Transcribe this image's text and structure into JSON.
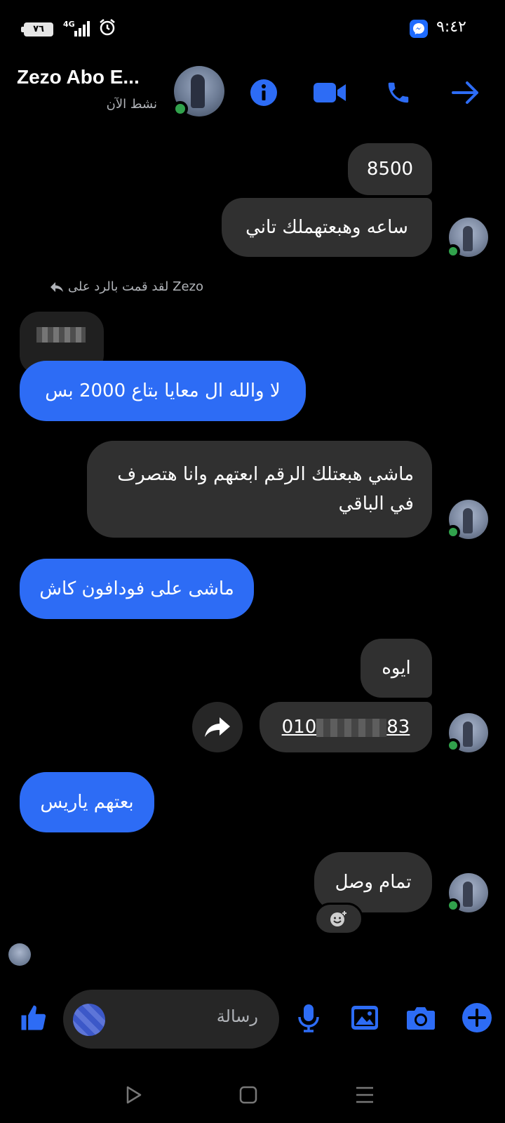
{
  "status_bar": {
    "battery": "٧٦",
    "network": "4G",
    "time": "٩:٤٢",
    "icons": [
      "signal-icon",
      "alarm-icon",
      "messenger-notification-icon"
    ]
  },
  "header": {
    "contact_name": "Zezo Abo E...",
    "contact_status": "نشط الآن",
    "icons": [
      "info-icon",
      "video-call-icon",
      "phone-call-icon",
      "back-arrow-icon"
    ]
  },
  "conversation": {
    "msg1": "8500",
    "msg2": "ساعه وهبعتهملك تاني",
    "reply_note": "لقد قمت بالرد على Zezo",
    "msg3": "لا والله ال معايا بتاع 2000 بس",
    "msg4_line1": "ماشي هبعتلك الرقم ابعتهم وانا هتصرف",
    "msg4_line2": "في الباقي",
    "msg5": "ماشى على فودافون كاش",
    "msg6": "ايوه",
    "msg7_prefix": "010",
    "msg7_suffix": "83",
    "msg8": "بعتهم ياريس",
    "msg9": "تمام وصل"
  },
  "composer": {
    "placeholder": "رسالة",
    "icons": [
      "like-icon",
      "microphone-icon",
      "gallery-icon",
      "camera-icon",
      "plus-icon"
    ]
  },
  "colors": {
    "accent": "#2d6cf5",
    "incoming_bubble": "#303030",
    "online": "#31a24c",
    "background": "#000000"
  }
}
